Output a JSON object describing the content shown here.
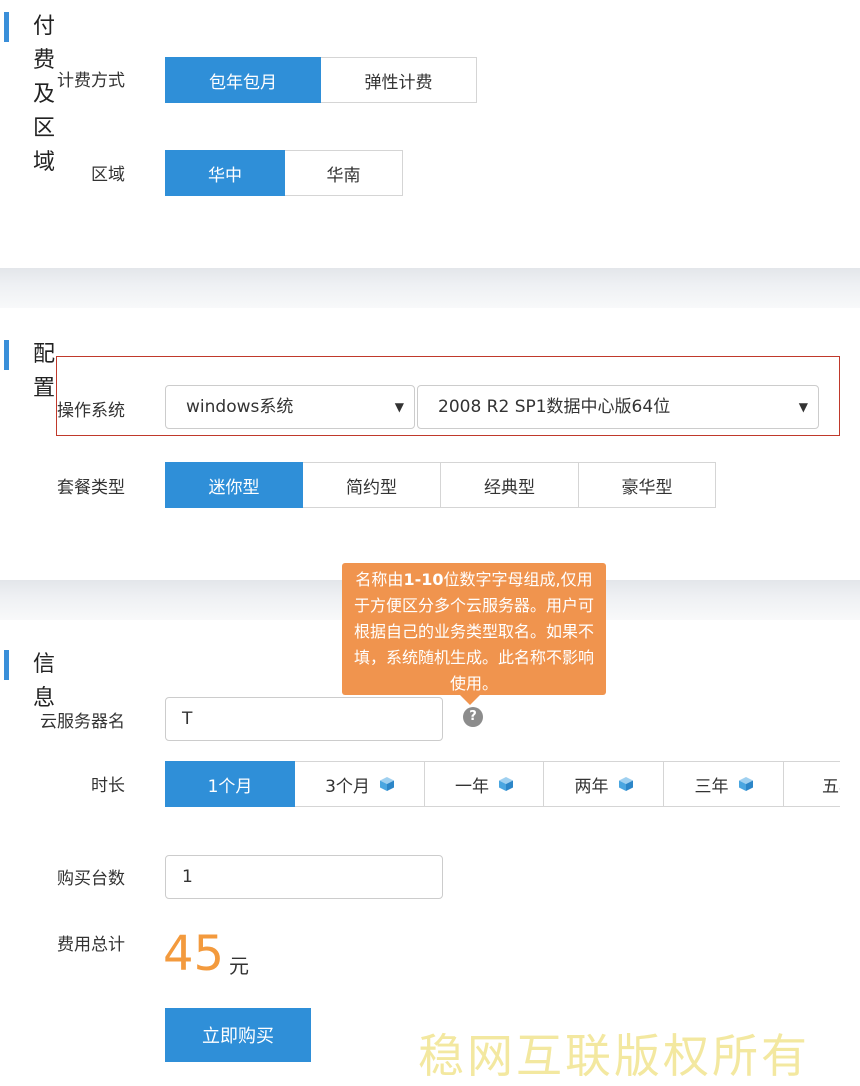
{
  "billing_section": {
    "title": "付费及区域",
    "billing_label": "计费方式",
    "billing_options": [
      "包年包月",
      "弹性计费"
    ],
    "region_label": "区域",
    "region_options": [
      "华中",
      "华南"
    ]
  },
  "config_section": {
    "title": "配置",
    "os_label": "操作系统",
    "os_type": "windows系统",
    "os_version": "2008 R2 SP1数据中心版64位",
    "package_label": "套餐类型",
    "package_options": [
      "迷你型",
      "简约型",
      "经典型",
      "豪华型"
    ]
  },
  "info_section": {
    "title": "信息",
    "tooltip": {
      "part1": "名称由",
      "bold": "1-10",
      "part2": "位数字字母组成,仅用于方便区分多个云服务器。用户可根据自己的业务类型取名。如果不填，系统随机生成。此名称不影响使用。"
    },
    "server_name_label": "云服务器名",
    "server_name_value": "T",
    "help_icon": "?",
    "duration_label": "时长",
    "duration_options": [
      "1个月",
      "3个月",
      "一年",
      "两年",
      "三年",
      "五年"
    ],
    "quantity_label": "购买台数",
    "quantity_value": "1",
    "total_label": "费用总计",
    "total_value": "45",
    "total_unit": "元",
    "buy_button": "立即购买"
  },
  "colors": {
    "accent": "#2f8fd8",
    "price": "#f39a3d",
    "tooltip": "#f0944e",
    "highlight_border": "#c0392b"
  },
  "watermark": "稳网互联版权所有"
}
